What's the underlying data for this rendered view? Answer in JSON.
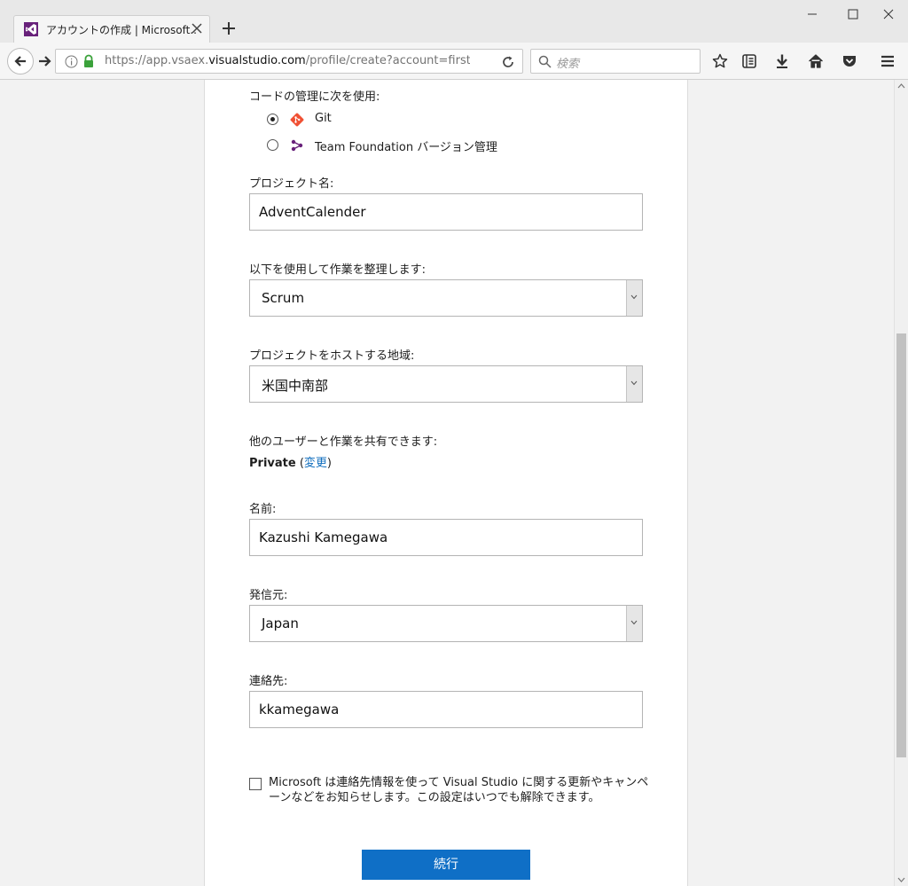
{
  "browser": {
    "tab_title": "アカウントの作成 | Microsoft...",
    "url_prefix": "https://app.vsaex.",
    "url_domain": "visualstudio.com",
    "url_suffix": "/profile/create?account=first&",
    "search_placeholder": "検索"
  },
  "form": {
    "vcs_label": "コードの管理に次を使用:",
    "vcs_options": [
      {
        "label": "Git",
        "selected": true
      },
      {
        "label": "Team Foundation バージョン管理",
        "selected": false
      }
    ],
    "project_name_label": "プロジェクト名:",
    "project_name_value": "AdventCalender",
    "process_label": "以下を使用して作業を整理します:",
    "process_value": "Scrum",
    "region_label": "プロジェクトをホストする地域:",
    "region_value": "米国中南部",
    "share_label": "他のユーザーと作業を共有できます:",
    "share_visibility": "Private",
    "share_open_paren": " (",
    "share_change_link": "変更",
    "share_close_paren": ")",
    "name_label": "名前:",
    "name_value": "Kazushi Kamegawa",
    "country_label": "発信元:",
    "country_value": "Japan",
    "contact_label": "連絡先:",
    "contact_value": "kkamegawa",
    "consent_text": "Microsoft は連絡先情報を使って Visual Studio に関する更新やキャンペーンなどをお知らせします。この設定はいつでも解除できます。",
    "consent_checked": false,
    "continue_label": "続行"
  },
  "colors": {
    "accent": "#0f6fc6",
    "git_orange": "#f05033",
    "vs_purple": "#68217a"
  }
}
